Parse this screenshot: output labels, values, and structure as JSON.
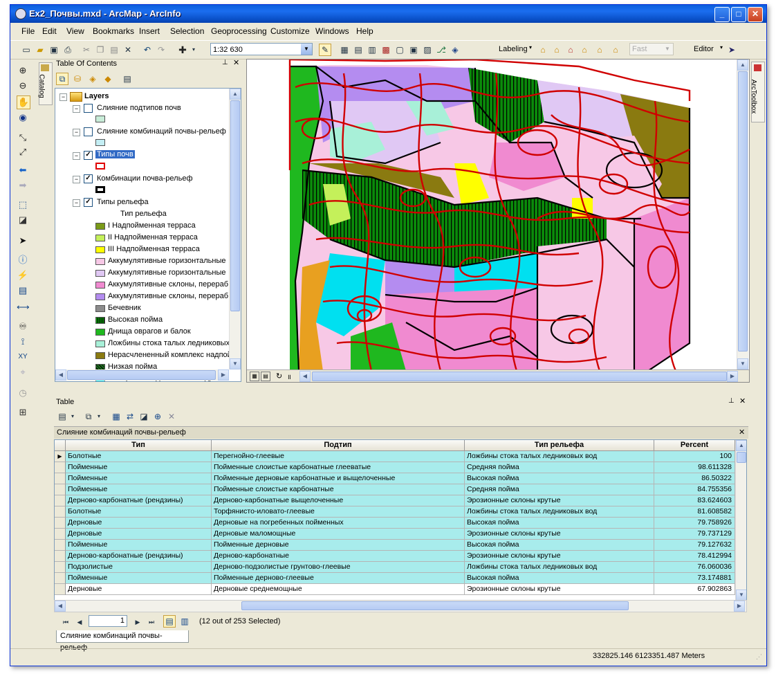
{
  "window": {
    "title": "Ex2_Почвы.mxd - ArcMap - ArcInfo",
    "btn_min": "_",
    "btn_max": "□",
    "btn_close": "✕"
  },
  "menu": [
    "File",
    "Edit",
    "View",
    "Bookmarks",
    "Insert",
    "Selection",
    "Geoprocessing",
    "Customize",
    "Windows",
    "Help"
  ],
  "toolbar": {
    "scale": "1:32 630",
    "labeling": "Labeling",
    "fast": "Fast",
    "editor": "Editor"
  },
  "catalog_tab": "Catalog",
  "arctoolbox_tab": "ArcToolbox",
  "toc": {
    "title": "Table Of Contents",
    "root": "Layers",
    "layers": [
      {
        "name": "Слияние подтипов почв",
        "checked": false
      },
      {
        "name": "Слияние комбинаций почвы-рельеф",
        "checked": false
      },
      {
        "name": "Типы почв",
        "checked": true,
        "selected": true
      },
      {
        "name": "Комбинации почва-рельеф",
        "checked": true
      },
      {
        "name": "Типы рельефа",
        "checked": true
      }
    ],
    "legend_field": "Тип рельефа",
    "legend": [
      {
        "label": "I Надпойменная терраса",
        "color": "#7a9a18"
      },
      {
        "label": "II Надпойменная терраса",
        "color": "#c4f05a"
      },
      {
        "label": "III Надпойменная терраса",
        "color": "#ffff00"
      },
      {
        "label": "Аккумулятивные горизонтальные",
        "color": "#f7c8e6"
      },
      {
        "label": "Аккумулятивные горизонтальные",
        "color": "#e0c8f4"
      },
      {
        "label": "Аккумулятивные склоны, перераб",
        "color": "#f08ad0"
      },
      {
        "label": "Аккумулятивные склоны, перераб",
        "color": "#b48cf0"
      },
      {
        "label": "Бечевник",
        "color": "#8c8c8c"
      },
      {
        "label": "Высокая пойма",
        "color": "#0a8a0a"
      },
      {
        "label": "Днища оврагов и балок",
        "color": "#1fb81f"
      },
      {
        "label": "Ложбины стока талых ледниковых",
        "color": "#a8f0d8"
      },
      {
        "label": "Нерасчлененный комплекс надпой",
        "color": "#8a7a10"
      },
      {
        "label": "Низкая пойма",
        "color": "#1c6e1c"
      },
      {
        "label": "Поверхности долинных зандров",
        "color": "#00e0f0"
      }
    ]
  },
  "table": {
    "panel_title": "Table",
    "layer_title": "Слияние комбинаций почвы-рельеф",
    "columns": [
      "Тип",
      "Подтип",
      "Тип рельефа",
      "Percent"
    ],
    "rows": [
      [
        "Болотные",
        "Перегнойно-глеевые",
        "Ложбины стока талых ледниковых вод",
        "100"
      ],
      [
        "Пойменные",
        "Пойменные слоистые карбонатные глееватые",
        "Средняя пойма",
        "98.611328"
      ],
      [
        "Пойменные",
        "Пойменные дерновые карбонатные и выщелоченные",
        "Высокая пойма",
        "86.50322"
      ],
      [
        "Пойменные",
        "Пойменные слоистые карбонатные",
        "Средняя пойма",
        "84.755356"
      ],
      [
        "Дерново-карбонатные (рендзины)",
        "Дерново-карбонатные выщелоченные",
        "Эрозионные склоны крутые",
        "83.624603"
      ],
      [
        "Болотные",
        "Торфянисто-иловато-глеевые",
        "Ложбины стока талых ледниковых вод",
        "81.608582"
      ],
      [
        "Дерновые",
        "Дерновые на погребенных пойменных",
        "Высокая пойма",
        "79.758926"
      ],
      [
        "Дерновые",
        "Дерновые маломощные",
        "Эрозионные склоны крутые",
        "79.737129"
      ],
      [
        "Пойменные",
        "Пойменные дерновые",
        "Высокая пойма",
        "79.127632"
      ],
      [
        "Дерново-карбонатные (рендзины)",
        "Дерново-карбонатные",
        "Эрозионные склоны крутые",
        "78.412994"
      ],
      [
        "Подзолистые",
        "Дерново-подзолистые грунтово-глеевые",
        "Ложбины стока талых ледниковых вод",
        "76.060036"
      ],
      [
        "Пойменные",
        "Пойменные дерново-глеевые",
        "Высокая пойма",
        "73.174881"
      ],
      [
        "Дерновые",
        "Дерновые среднемощные",
        "Эрозионные склоны крутые",
        "67.902863"
      ]
    ],
    "record": "1",
    "selection": "(12 out of 253 Selected)",
    "tab_label": "Слияние комбинаций почвы-рельеф"
  },
  "status": {
    "coords": "332825.146  6123351.487 Meters"
  },
  "colors": {
    "selected_row": "#a8ecec",
    "title_bar": "#0a5ddb",
    "highlight": "#316ac5"
  }
}
